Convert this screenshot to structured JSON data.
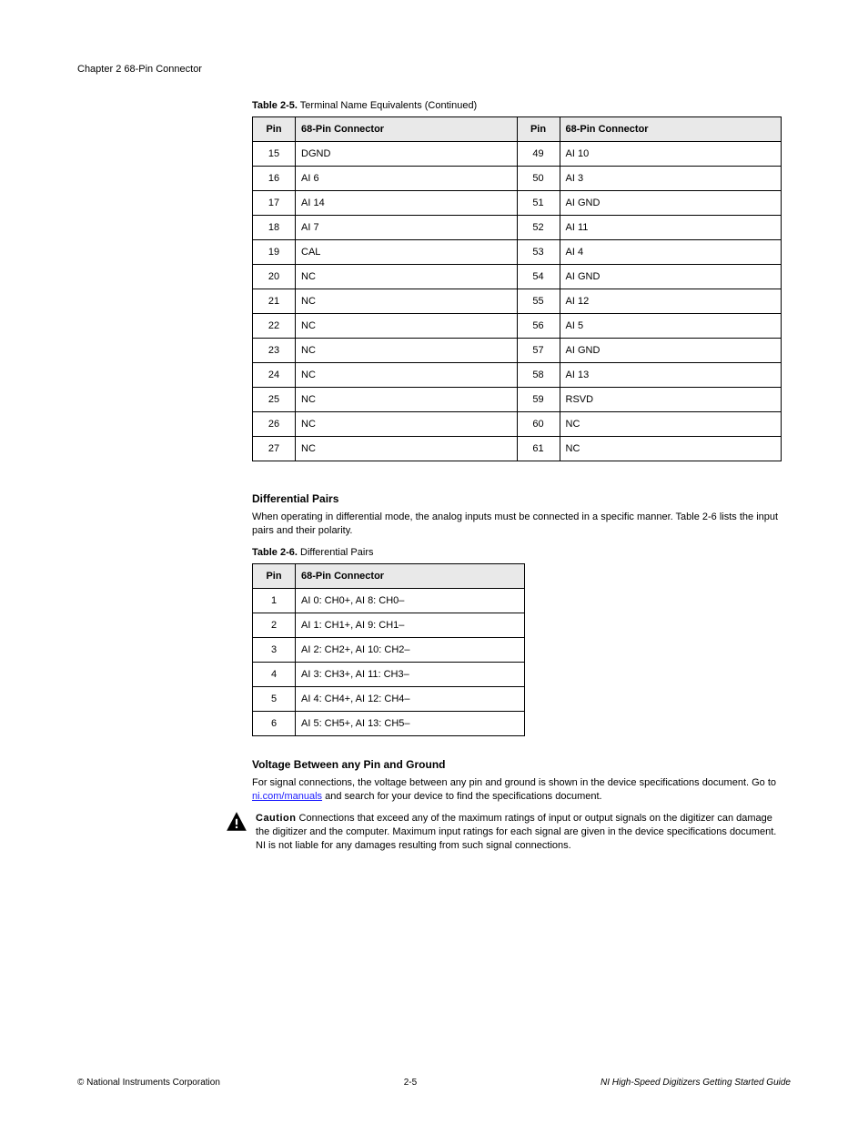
{
  "header": "Chapter 2   68-Pin Connector",
  "table2_5": {
    "caption_label": "Table 2-5.",
    "caption_text": "Terminal Name Equivalents (Continued)",
    "headers": [
      "Pin",
      "68-Pin Connector",
      "Pin",
      "68-Pin Connector"
    ],
    "rows": [
      [
        "15",
        "DGND",
        "49",
        "AI 10"
      ],
      [
        "16",
        "AI 6",
        "50",
        "AI 3"
      ],
      [
        "17",
        "AI 14",
        "51",
        "AI GND"
      ],
      [
        "18",
        "AI 7",
        "52",
        "AI 11"
      ],
      [
        "19",
        "CAL",
        "53",
        "AI 4"
      ],
      [
        "20",
        "NC",
        "54",
        "AI GND"
      ],
      [
        "21",
        "NC",
        "55",
        "AI 12"
      ],
      [
        "22",
        "NC",
        "56",
        "AI 5"
      ],
      [
        "23",
        "NC",
        "57",
        "AI GND"
      ],
      [
        "24",
        "NC",
        "58",
        "AI 13"
      ],
      [
        "25",
        "NC",
        "59",
        "RSVD"
      ],
      [
        "26",
        "NC",
        "60",
        "NC"
      ],
      [
        "27",
        "NC",
        "61",
        "NC"
      ]
    ]
  },
  "differential": {
    "heading": "Differential Pairs",
    "para1": "When operating in differential mode, the analog inputs must be connected in a specific manner. Table 2-6 lists the input pairs and their polarity.",
    "table_caption_label": "Table 2-6.",
    "table_caption_text": "Differential Pairs",
    "headers": [
      "Pin",
      "68-Pin Connector"
    ],
    "rows": [
      [
        "1",
        "AI 0: CH0+, AI 8: CH0–"
      ],
      [
        "2",
        "AI 1: CH1+, AI 9: CH1–"
      ],
      [
        "3",
        "AI 2: CH2+, AI 10: CH2–"
      ],
      [
        "4",
        "AI 3: CH3+, AI 11: CH3–"
      ],
      [
        "5",
        "AI 4: CH4+, AI 12: CH4–"
      ],
      [
        "6",
        "AI 5: CH5+, AI 13: CH5–"
      ]
    ]
  },
  "voltage": {
    "heading": "Voltage Between any Pin and Ground",
    "para1_pre": "For signal connections, the voltage between any pin and ground is shown in the device specifications document. Go to ",
    "link_text": "ni.com/manuals",
    "para1_post": " and search for your device to find the specifications document.",
    "caution_label": "Caution",
    "caution_text": "  Connections that exceed any of the maximum ratings of input or output signals on the digitizer can damage the digitizer and the computer. Maximum input ratings for each signal are given in the device specifications document. NI is not liable for any damages resulting from such signal connections."
  },
  "footer": {
    "left": "© National Instruments Corporation",
    "center": "2-5",
    "right": "NI High-Speed Digitizers Getting Started Guide"
  }
}
